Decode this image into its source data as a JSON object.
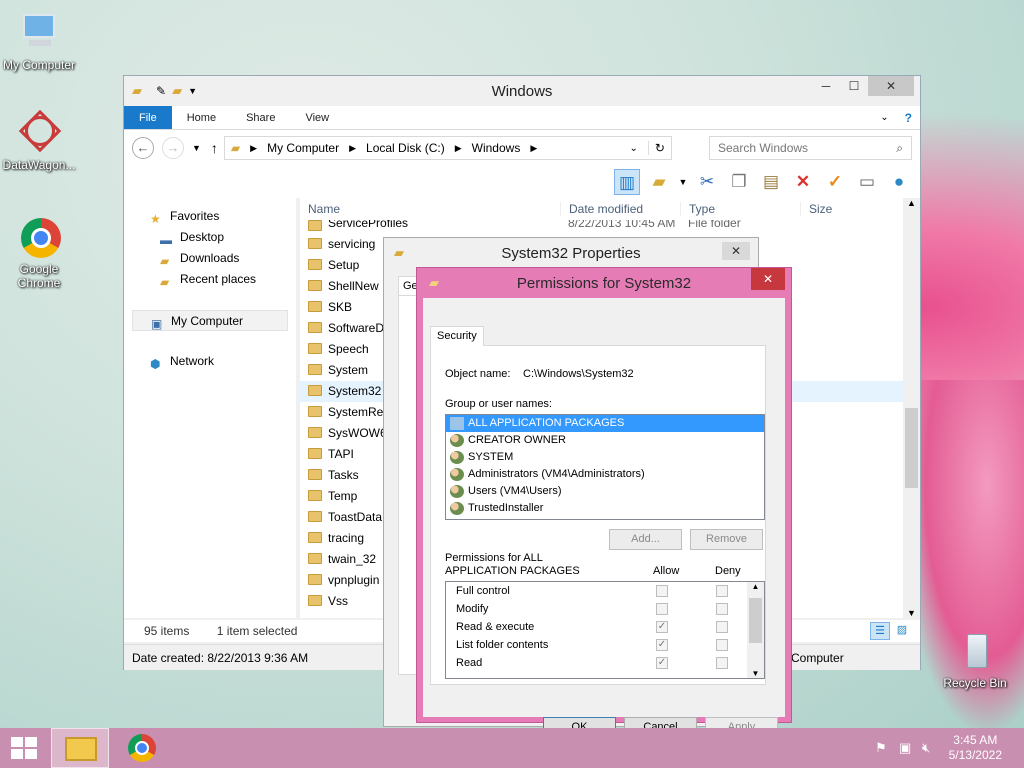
{
  "desktop": {
    "icons": [
      {
        "label": "My Computer"
      },
      {
        "label": "DataWagon..."
      },
      {
        "label": "Google Chrome"
      },
      {
        "label": "Recycle Bin"
      }
    ]
  },
  "explorer": {
    "title": "Windows",
    "ribbon_tabs": [
      "File",
      "Home",
      "Share",
      "View"
    ],
    "breadcrumb": [
      "My Computer",
      "Local Disk (C:)",
      "Windows"
    ],
    "search_placeholder": "Search Windows",
    "nav": {
      "favorites": "Favorites",
      "desktop": "Desktop",
      "downloads": "Downloads",
      "recent": "Recent places",
      "my_computer": "My Computer",
      "network": "Network"
    },
    "columns": [
      "Name",
      "Date modified",
      "Type",
      "Size"
    ],
    "first_row": {
      "name": "ServiceProfiles",
      "date": "8/22/2013 10:45 AM",
      "type": "File folder"
    },
    "files": [
      "servicing",
      "Setup",
      "ShellNew",
      "SKB",
      "SoftwareD",
      "Speech",
      "System",
      "System32",
      "SystemRes",
      "SysWOW6",
      "TAPI",
      "Tasks",
      "Temp",
      "ToastData",
      "tracing",
      "twain_32",
      "vpnplugin",
      "Vss"
    ],
    "status_count": "95 items",
    "status_selected": "1 item selected",
    "details": "Date created: 8/22/2013 9:36 AM",
    "details_right": "Computer"
  },
  "properties": {
    "title": "System32 Properties",
    "tab_partial": "Ge"
  },
  "permissions": {
    "title": "Permissions for System32",
    "tab": "Security",
    "object_label": "Object name:",
    "object_value": "C:\\Windows\\System32",
    "group_label": "Group or user names:",
    "users": [
      "ALL APPLICATION PACKAGES",
      "CREATOR OWNER",
      "SYSTEM",
      "Administrators (VM4\\Administrators)",
      "Users (VM4\\Users)",
      "TrustedInstaller"
    ],
    "add_btn": "Add...",
    "remove_btn": "Remove",
    "perm_label_1": "Permissions for ALL",
    "perm_label_2": "APPLICATION PACKAGES",
    "allow": "Allow",
    "deny": "Deny",
    "perms": [
      {
        "name": "Full control",
        "allow": false
      },
      {
        "name": "Modify",
        "allow": false
      },
      {
        "name": "Read & execute",
        "allow": true
      },
      {
        "name": "List folder contents",
        "allow": true
      },
      {
        "name": "Read",
        "allow": true
      }
    ],
    "ok": "OK",
    "cancel": "Cancel",
    "apply": "Apply"
  },
  "taskbar": {
    "time": "3:45 AM",
    "date": "5/13/2022"
  }
}
